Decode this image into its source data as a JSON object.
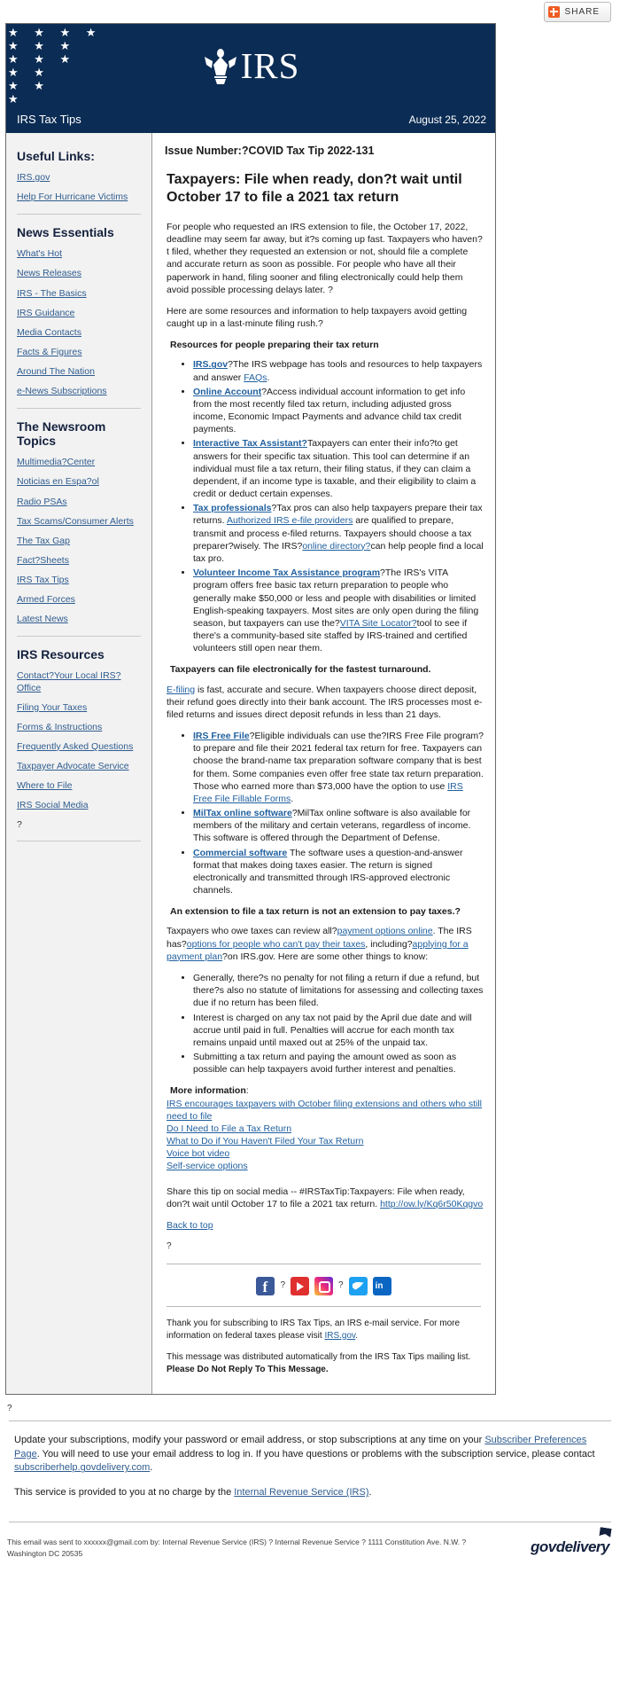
{
  "share": {
    "label": "SHARE",
    "icon": "plus-icon"
  },
  "masthead": {
    "logo_text": "IRS",
    "seal_icon": "irs-eagle-seal-icon",
    "flag_icon": "us-flag-icon"
  },
  "title_strip": {
    "publication": "IRS Tax Tips",
    "date": "August 25, 2022"
  },
  "sidebar": {
    "sections": [
      {
        "heading": "Useful Links:",
        "links": [
          "IRS.gov",
          "Help For Hurricane Victims"
        ]
      },
      {
        "heading": "News Essentials",
        "links": [
          "What's Hot",
          "News Releases",
          "IRS - The Basics",
          "IRS Guidance",
          "Media Contacts",
          "Facts & Figures",
          "Around The Nation",
          "e-News Subscriptions"
        ]
      },
      {
        "heading": "The Newsroom Topics",
        "links": [
          "Multimedia?Center",
          "Noticias en Espa?ol",
          "Radio PSAs",
          "Tax Scams/Consumer Alerts",
          "The Tax Gap",
          "Fact?Sheets",
          "IRS Tax Tips",
          "Armed Forces",
          "Latest News"
        ]
      },
      {
        "heading": "IRS Resources",
        "links": [
          "Contact?Your Local IRS?Office",
          "Filing Your Taxes",
          "Forms & Instructions",
          "Frequently Asked Questions",
          "Taxpayer Advocate Service",
          "Where to File",
          "IRS Social Media"
        ],
        "trailing_text": "?"
      }
    ]
  },
  "main": {
    "issue_number": "Issue Number:?COVID Tax Tip 2022-131",
    "headline": "Taxpayers: File when ready, don?t wait until October 17 to file a 2021 tax return",
    "intro_paragraph": "For people who requested an IRS extension to file, the October 17, 2022, deadline may seem far away, but it?s coming up fast. Taxpayers who haven?t filed, whether they requested an extension or not, should file a complete and accurate return as soon as possible. For people who have all their paperwork in hand, filing sooner and filing electronically could help them avoid possible processing delays later. ?",
    "second_paragraph": "Here are some resources and information to help taxpayers avoid getting caught up in a last-minute filing rush.?",
    "resources_heading": "Resources for people preparing their tax return",
    "resources_bullets": [
      {
        "link": "IRS.gov",
        "text_1": "?The IRS webpage has tools and resources to help taxpayers and answer ",
        "link_2": "FAQs",
        "text_2": "."
      },
      {
        "link": "Online Account",
        "text_1": "?Access individual account information to get info from the most recently filed tax return, including adjusted gross income, Economic Impact Payments and advance child tax credit payments."
      },
      {
        "link": "Interactive Tax Assistant?",
        "text_1": "Taxpayers can enter their info?to get answers for their specific tax situation. This tool can determine if an individual must file a tax return, their filing status, if they can claim a dependent, if an income type is taxable, and their eligibility to claim a credit or deduct certain expenses."
      },
      {
        "link": "Tax professionals",
        "text_1": "?Tax pros can also help taxpayers prepare their tax returns. ",
        "link_2": "Authorized IRS e-file providers",
        "text_2": " are qualified to prepare, transmit and process e-filed returns. Taxpayers should choose a tax preparer?wisely. The IRS?",
        "link_3": "online directory?",
        "text_3": "can help people find a local tax pro."
      },
      {
        "link": "Volunteer Income Tax Assistance program",
        "text_1": "?The IRS's VITA program offers free basic tax return preparation to people who generally make $50,000 or less and people with disabilities or limited English-speaking taxpayers. Most sites are only open during the filing season, but taxpayers can use the?",
        "link_2": "VITA Site Locator?",
        "text_2": "tool to see if there's a community-based site staffed by IRS-trained and certified volunteers still open near them."
      }
    ],
    "efile_heading": "Taxpayers can file electronically for the fastest turnaround.",
    "efile_paragraph_link": "E-filing",
    "efile_paragraph": " is fast, accurate and secure. When taxpayers choose direct deposit, their refund goes directly into their bank account. The IRS processes most e-filed returns and issues direct deposit refunds in less than 21 days.",
    "efile_bullets": [
      {
        "link": "IRS Free File",
        "text_1": "?Eligible individuals can use the?IRS Free File program? to prepare and file their 2021 federal tax return for free. Taxpayers can choose the brand-name tax preparation software company that is best for them. Some companies even offer free state tax return preparation. Those who earned more than $73,000 have the option to use ",
        "link_2": "IRS Free File Fillable Forms",
        "text_2": "."
      },
      {
        "link": "MilTax online software",
        "text_1": "?MilTax online software is also available for members of the military and certain veterans, regardless of income. This software is offered through the Department of Defense."
      },
      {
        "link": "Commercial software",
        "text_1": " The software uses a question-and-answer format that makes doing taxes easier. The return is signed electronically and transmitted through IRS-approved electronic channels."
      }
    ],
    "extension_heading": "An extension to file a tax return is not an extension to pay taxes.?",
    "extension_paragraph_1": "Taxpayers who owe taxes can review all?",
    "extension_link_1": "payment options online",
    "extension_paragraph_2": ". The IRS has?",
    "extension_link_2": "options for people who can't pay their taxes",
    "extension_paragraph_3": ", including?",
    "extension_link_3": "applying for a payment plan",
    "extension_paragraph_4": "?on IRS.gov. Here are some other things to know:",
    "extension_bullets": [
      "Generally, there?s no penalty for not filing a return if due a refund, but there?s also no statute of limitations for assessing and collecting taxes due if no return has been filed.",
      "Interest is charged on any tax not paid by the April due date and will accrue until paid in full. Penalties will accrue for each month tax remains unpaid until maxed out at 25% of the unpaid tax.",
      "Submitting a tax return and paying the amount owed as soon as possible can help taxpayers avoid further interest and penalties."
    ],
    "more_info_heading": "More information",
    "more_info_colon": ":",
    "more_info_links": [
      "IRS encourages taxpayers with October filing extensions and others who still need to file",
      "Do I Need to File a Tax Return",
      "What to Do if You Haven't Filed Your Tax Return",
      "Voice bot video",
      "Self-service options"
    ],
    "share_tip_text": "Share this tip on social media -- #IRSTaxTip:Taxpayers: File when ready, don?t wait until October 17 to file a 2021 tax return. ",
    "share_tip_link": "http://ow.ly/Kq6r50Kqgvo",
    "back_to_top": "Back to top",
    "trailing_q": "?",
    "social_icons": [
      "facebook-icon",
      "youtube-icon",
      "instagram-icon",
      "twitter-icon",
      "linkedin-icon"
    ],
    "social_q_marks": [
      "?",
      "?"
    ],
    "thanks_text_1": "Thank you for subscribing to IRS Tax Tips, an IRS e-mail service. For more information on federal taxes please visit ",
    "thanks_link": "IRS.gov",
    "thanks_text_2": ".",
    "distributed_text_1": "This message was distributed automatically from the IRS Tax Tips mailing list. ",
    "distributed_bold": "Please Do Not Reply To This Message."
  },
  "outer_footer": {
    "q_mark": "?",
    "update_text_1": "Update your subscriptions, modify your password or email address, or stop subscriptions at any time on your ",
    "update_link_1": "Subscriber Preferences Page",
    "update_text_2": ". You will need to use your email address to log in. If you have questions or problems with the subscription service, please contact ",
    "update_link_2": "subscriberhelp.govdelivery.com",
    "update_text_3": ".",
    "free_text_1": "This service is provided to you at no charge by the ",
    "free_link": "Internal Revenue Service (IRS)",
    "free_text_2": ".",
    "sent_to_text": "This email was sent to xxxxxx@gmail.com by: Internal Revenue Service (IRS) ? Internal Revenue Service ? 1111 Constitution Ave. N.W. ? Washington DC 20535",
    "brand": "govdelivery"
  }
}
